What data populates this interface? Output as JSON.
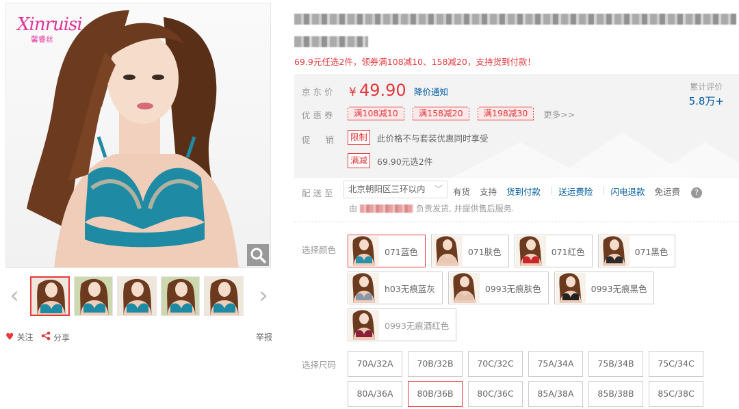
{
  "gallery": {
    "brand_logo": "Xinruisi",
    "brand_logo_sub": "馨睿丝",
    "thumbnails": [
      {
        "id": "thumb-1",
        "active": true
      },
      {
        "id": "thumb-2",
        "active": false
      },
      {
        "id": "thumb-3",
        "active": false
      },
      {
        "id": "thumb-4",
        "active": false
      },
      {
        "id": "thumb-5",
        "active": false
      }
    ],
    "follow_label": "关注",
    "share_label": "分享",
    "report_label": "举报",
    "prev_icon": "‹",
    "next_icon": "›",
    "accent_color": "#e4393c",
    "icons": [
      "zoom-icon",
      "heart-icon",
      "share-icon",
      "chevron-left-icon",
      "chevron-right-icon"
    ]
  },
  "product": {
    "promo_news": "69.9元任选2件，领券满108减10、158减20，支持货到付款！"
  },
  "summary": {
    "price_label": "京东价",
    "currency": "¥",
    "price": "49.90",
    "price_notice": "降价通知",
    "rating_label": "累计评价",
    "rating_value": "5.8万+",
    "coupon_label": "优惠券",
    "coupons": [
      "满108减10",
      "满158减20",
      "满198减30"
    ],
    "more_label": "更多>>",
    "promo_label": "促销",
    "promotions": [
      {
        "tag": "限制",
        "text": "此价格不与套装优惠同时享受"
      },
      {
        "tag": "满减",
        "text": "69.90元选2件"
      }
    ]
  },
  "delivery": {
    "label": "配送至",
    "address": "北京朝阳区三环以内",
    "stock": "有货",
    "support": "支持",
    "services": [
      "货到付款",
      "送运费险",
      "闪电退款"
    ],
    "freight": "免运费",
    "help_icon": "?",
    "seller_prefix": "由",
    "seller_suffix": "负责发货, 并提供售后服务."
  },
  "color_select": {
    "label": "选择颜色",
    "options": [
      {
        "name": "071蓝色",
        "selected": true,
        "disabled": false,
        "swatch": "#2a8fa8"
      },
      {
        "name": "071肤色",
        "selected": false,
        "disabled": false,
        "swatch": "#e8c7b3"
      },
      {
        "name": "071红色",
        "selected": false,
        "disabled": false,
        "swatch": "#c8262c"
      },
      {
        "name": "071黑色",
        "selected": false,
        "disabled": false,
        "swatch": "#2b2b2b"
      },
      {
        "name": "h03无痕蓝灰",
        "selected": false,
        "disabled": false,
        "swatch": "#8a97a8"
      },
      {
        "name": "0993无痕肤色",
        "selected": false,
        "disabled": false,
        "swatch": "#e3c2ad"
      },
      {
        "name": "0993无痕黑色",
        "selected": false,
        "disabled": false,
        "swatch": "#222222"
      },
      {
        "name": "0993无痕酒红色",
        "selected": false,
        "disabled": true,
        "swatch": "#8c1f3a"
      }
    ]
  },
  "size_select": {
    "label": "选择尺码",
    "options": [
      {
        "name": "70A/32A",
        "selected": false
      },
      {
        "name": "70B/32B",
        "selected": false
      },
      {
        "name": "70C/32C",
        "selected": false
      },
      {
        "name": "75A/34A",
        "selected": false
      },
      {
        "name": "75B/34B",
        "selected": false
      },
      {
        "name": "75C/34C",
        "selected": false
      },
      {
        "name": "80A/36A",
        "selected": false
      },
      {
        "name": "80B/36B",
        "selected": true
      },
      {
        "name": "80C/36C",
        "selected": false
      },
      {
        "name": "85A/38A",
        "selected": false
      },
      {
        "name": "85B/38B",
        "selected": false
      },
      {
        "name": "85C/38C",
        "selected": false
      }
    ]
  }
}
